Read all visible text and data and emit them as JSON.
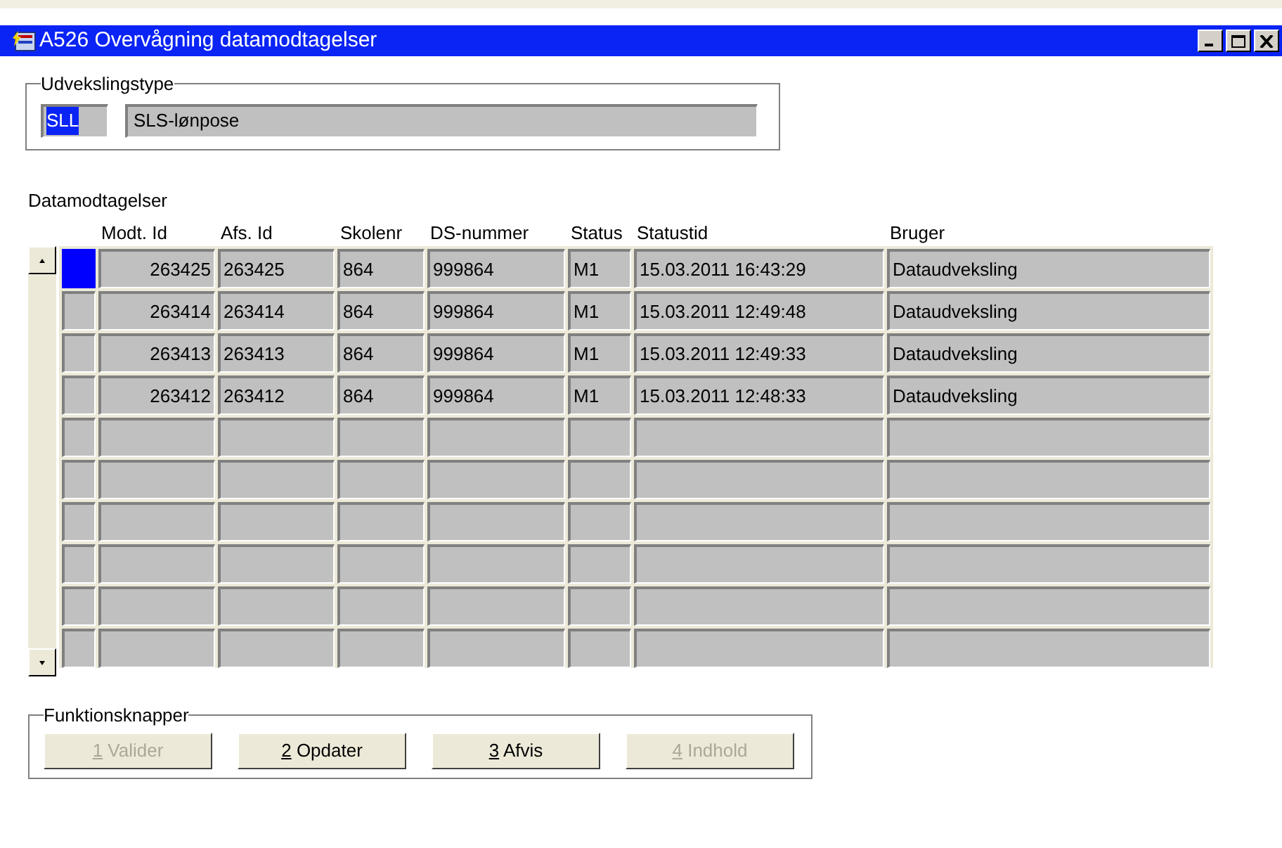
{
  "window": {
    "title": "A526 Overvågning datamodtagelser"
  },
  "exchange_type": {
    "legend": "Udvekslingstype",
    "code": {
      "value": "SLL",
      "selected": true
    },
    "description": "SLS-lønpose"
  },
  "list_label": "Datamodtagelser",
  "table": {
    "columns": [
      "Modt. Id",
      "Afs. Id",
      "Skolenr",
      "DS-nummer",
      "Status",
      "Statustid",
      "Bruger"
    ],
    "rows": [
      {
        "selected": true,
        "cells": [
          "263425",
          "263425",
          "864",
          "999864",
          "M1",
          "15.03.2011 16:43:29",
          "Dataudveksling"
        ]
      },
      {
        "selected": false,
        "cells": [
          "263414",
          "263414",
          "864",
          "999864",
          "M1",
          "15.03.2011 12:49:48",
          "Dataudveksling"
        ]
      },
      {
        "selected": false,
        "cells": [
          "263413",
          "263413",
          "864",
          "999864",
          "M1",
          "15.03.2011 12:49:33",
          "Dataudveksling"
        ]
      },
      {
        "selected": false,
        "cells": [
          "263412",
          "263412",
          "864",
          "999864",
          "M1",
          "15.03.2011 12:48:33",
          "Dataudveksling"
        ]
      }
    ]
  },
  "function_buttons": {
    "legend": "Funktionsknapper",
    "buttons": [
      {
        "key": "1",
        "label": "Valider",
        "disabled": true
      },
      {
        "key": "2",
        "label": "Opdater",
        "disabled": false
      },
      {
        "key": "3",
        "label": "Afvis",
        "disabled": false
      },
      {
        "key": "4",
        "label": "Indhold",
        "disabled": true
      }
    ]
  }
}
